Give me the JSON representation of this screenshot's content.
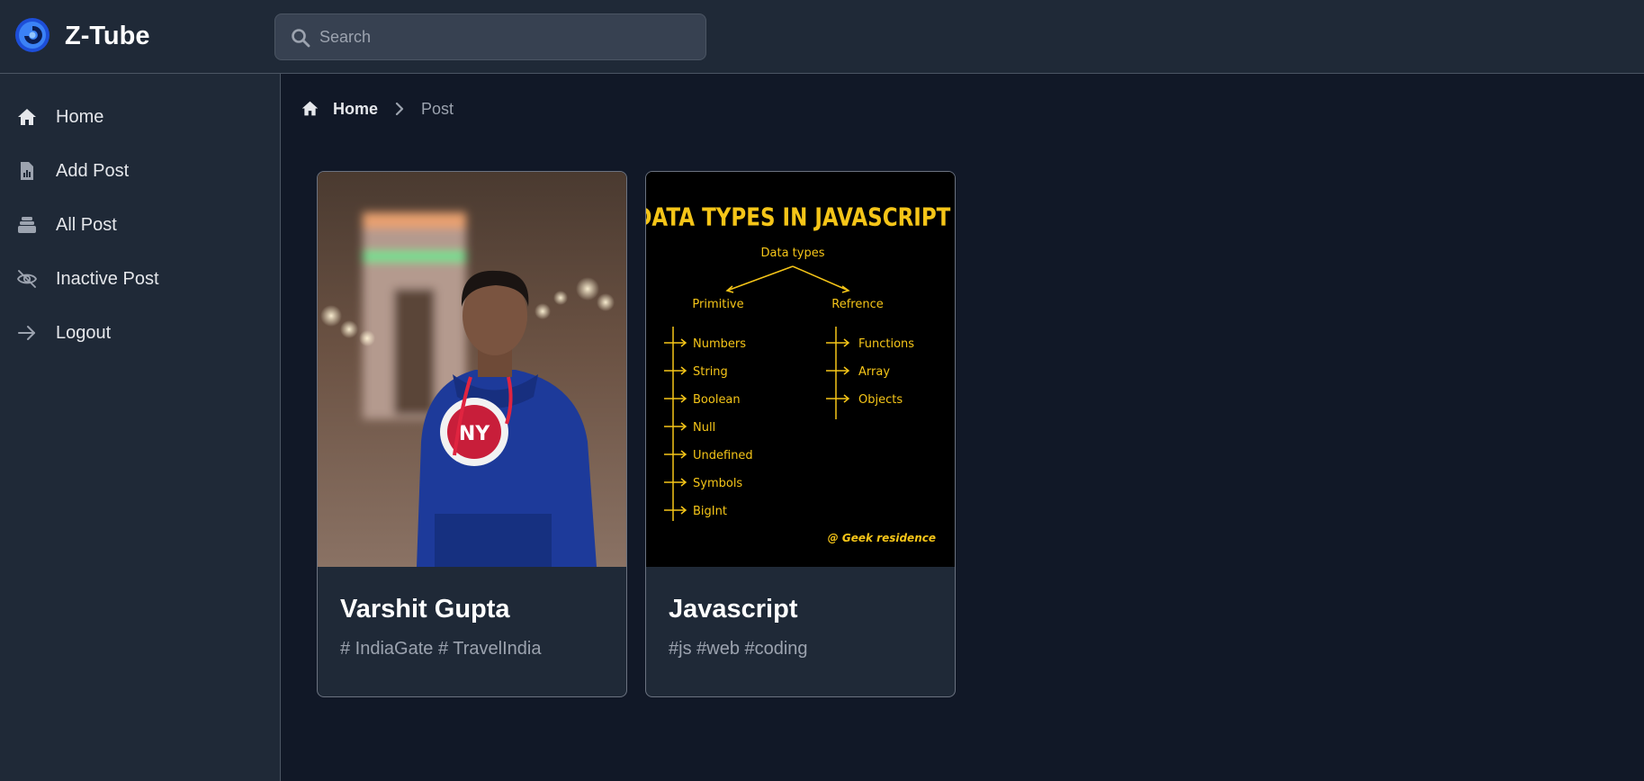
{
  "app": {
    "brand": "Z-Tube",
    "logo_icon": "z-tube-logo-icon",
    "accent_color": "#2563eb"
  },
  "search": {
    "placeholder": "Search",
    "value": "",
    "icon": "search-icon"
  },
  "sidebar": {
    "items": [
      {
        "label": "Home",
        "icon": "home-icon"
      },
      {
        "label": "Add Post",
        "icon": "document-chart-icon"
      },
      {
        "label": "All Post",
        "icon": "stack-icon"
      },
      {
        "label": "Inactive Post",
        "icon": "eye-slash-icon"
      },
      {
        "label": "Logout",
        "icon": "arrow-right-icon"
      }
    ]
  },
  "breadcrumb": {
    "home_label": "Home",
    "current_label": "Post",
    "home_icon": "home-icon",
    "separator_icon": "chevron-right-icon"
  },
  "posts": [
    {
      "title": "Varshit Gupta",
      "tags": "# IndiaGate # TravelIndia"
    },
    {
      "title": "Javascript",
      "tags": "#js #web #coding",
      "image_text": {
        "heading": "DATA TYPES IN JAVASCRIPT",
        "root": "Data types",
        "primitive_label": "Primitive",
        "reference_label": "Refrence",
        "primitive": [
          "Numbers",
          "String",
          "Boolean",
          "Null",
          "Undefined",
          "Symbols",
          "BigInt"
        ],
        "reference": [
          "Functions",
          "Array",
          "Objects"
        ],
        "credit": "@ Geek residence"
      }
    }
  ]
}
